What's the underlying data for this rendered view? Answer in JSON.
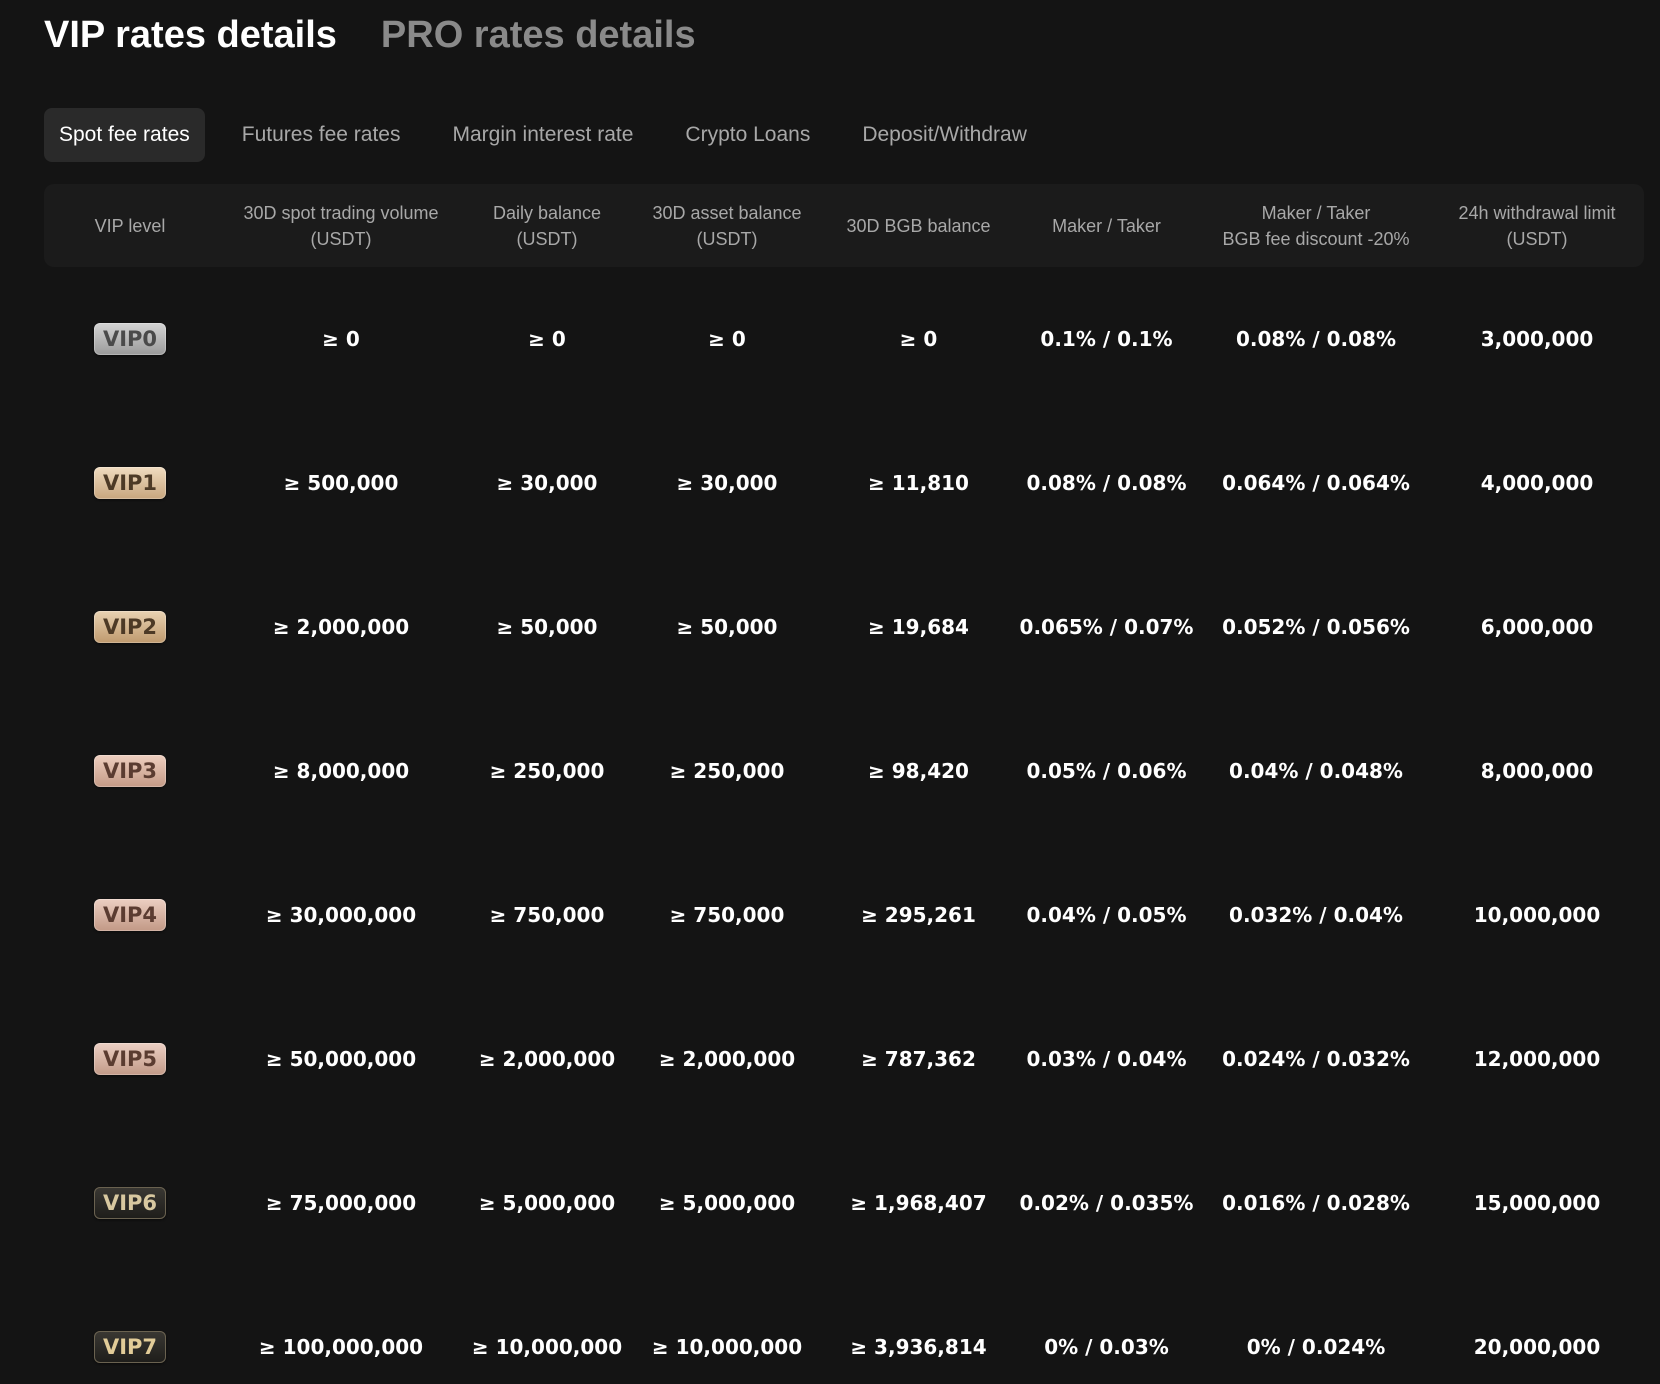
{
  "titles": {
    "vip": "VIP rates details",
    "pro": "PRO rates details"
  },
  "tabs": [
    {
      "label": "Spot fee rates",
      "active": true
    },
    {
      "label": "Futures fee rates",
      "active": false
    },
    {
      "label": "Margin interest rate",
      "active": false
    },
    {
      "label": "Crypto Loans",
      "active": false
    },
    {
      "label": "Deposit/Withdraw",
      "active": false
    }
  ],
  "table": {
    "headers": [
      "VIP level",
      "30D spot trading volume\n(USDT)",
      "Daily balance\n(USDT)",
      "30D asset balance\n(USDT)",
      "30D BGB balance",
      "Maker / Taker",
      "Maker / Taker\nBGB fee discount -20%",
      "24h withdrawal limit\n(USDT)"
    ],
    "rows": [
      {
        "level": "VIP0",
        "volume": "≥ 0",
        "daily": "≥ 0",
        "asset": "≥ 0",
        "bgb": "≥ 0",
        "fee": "0.1% / 0.1%",
        "fee_bgb": "0.08% / 0.08%",
        "limit": "3,000,000"
      },
      {
        "level": "VIP1",
        "volume": "≥ 500,000",
        "daily": "≥ 30,000",
        "asset": "≥ 30,000",
        "bgb": "≥ 11,810",
        "fee": "0.08% / 0.08%",
        "fee_bgb": "0.064% / 0.064%",
        "limit": "4,000,000"
      },
      {
        "level": "VIP2",
        "volume": "≥ 2,000,000",
        "daily": "≥ 50,000",
        "asset": "≥ 50,000",
        "bgb": "≥ 19,684",
        "fee": "0.065% / 0.07%",
        "fee_bgb": "0.052% / 0.056%",
        "limit": "6,000,000"
      },
      {
        "level": "VIP3",
        "volume": "≥ 8,000,000",
        "daily": "≥ 250,000",
        "asset": "≥ 250,000",
        "bgb": "≥ 98,420",
        "fee": "0.05% / 0.06%",
        "fee_bgb": "0.04% / 0.048%",
        "limit": "8,000,000"
      },
      {
        "level": "VIP4",
        "volume": "≥ 30,000,000",
        "daily": "≥ 750,000",
        "asset": "≥ 750,000",
        "bgb": "≥ 295,261",
        "fee": "0.04% / 0.05%",
        "fee_bgb": "0.032% / 0.04%",
        "limit": "10,000,000"
      },
      {
        "level": "VIP5",
        "volume": "≥ 50,000,000",
        "daily": "≥ 2,000,000",
        "asset": "≥ 2,000,000",
        "bgb": "≥ 787,362",
        "fee": "0.03% / 0.04%",
        "fee_bgb": "0.024% / 0.032%",
        "limit": "12,000,000"
      },
      {
        "level": "VIP6",
        "volume": "≥ 75,000,000",
        "daily": "≥ 5,000,000",
        "asset": "≥ 5,000,000",
        "bgb": "≥ 1,968,407",
        "fee": "0.02% / 0.035%",
        "fee_bgb": "0.016% / 0.028%",
        "limit": "15,000,000"
      },
      {
        "level": "VIP7",
        "volume": "≥ 100,000,000",
        "daily": "≥ 10,000,000",
        "asset": "≥ 10,000,000",
        "bgb": "≥ 3,936,814",
        "fee": "0% / 0.03%",
        "fee_bgb": "0% / 0.024%",
        "limit": "20,000,000"
      }
    ]
  }
}
